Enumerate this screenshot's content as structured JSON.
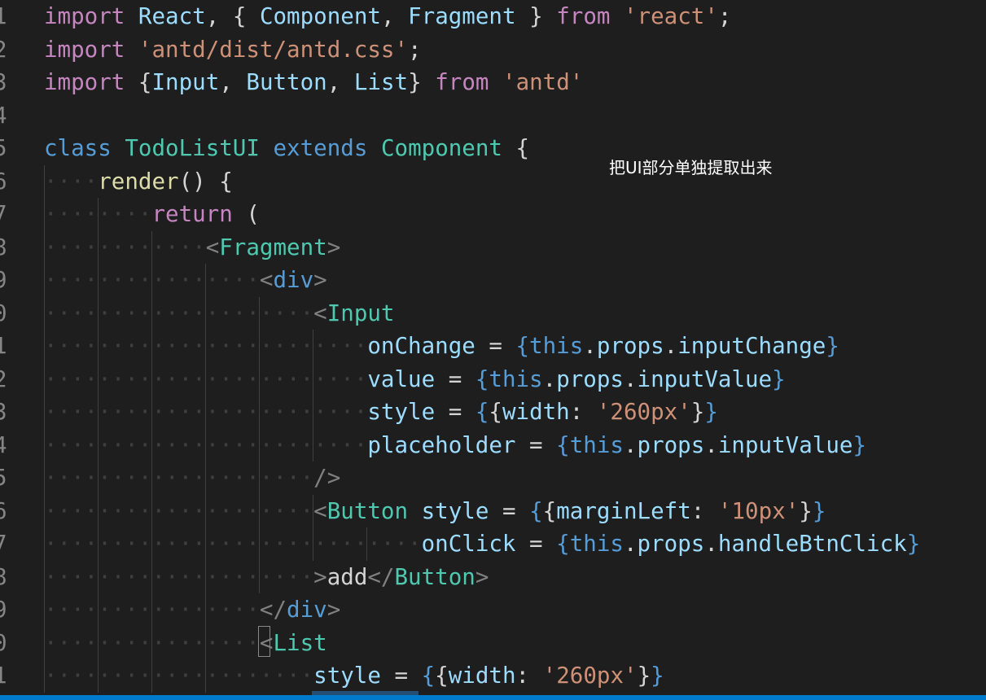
{
  "editor": {
    "annotation": "把UI部分单独提取出来",
    "line_numbers": [
      "1",
      "2",
      "3",
      "4",
      "5",
      "6",
      "7",
      "8",
      "9",
      "0",
      "1",
      "2",
      "3",
      "4",
      "5",
      "6",
      "7",
      "8",
      "9",
      "0",
      "1"
    ],
    "lines": [
      [
        {
          "t": "import",
          "c": "kw"
        },
        {
          "t": " ",
          "c": "ws"
        },
        {
          "t": "React",
          "c": "var"
        },
        {
          "t": ", { ",
          "c": "pun"
        },
        {
          "t": "Component",
          "c": "var"
        },
        {
          "t": ", ",
          "c": "pun"
        },
        {
          "t": "Fragment",
          "c": "var"
        },
        {
          "t": " } ",
          "c": "pun"
        },
        {
          "t": "from",
          "c": "kw"
        },
        {
          "t": " ",
          "c": "ws"
        },
        {
          "t": "'react'",
          "c": "str"
        },
        {
          "t": ";",
          "c": "pun"
        }
      ],
      [
        {
          "t": "import",
          "c": "kw"
        },
        {
          "t": " ",
          "c": "ws"
        },
        {
          "t": "'antd/dist/antd.css'",
          "c": "str"
        },
        {
          "t": ";",
          "c": "pun"
        }
      ],
      [
        {
          "t": "import",
          "c": "kw"
        },
        {
          "t": " {",
          "c": "pun"
        },
        {
          "t": "Input",
          "c": "var"
        },
        {
          "t": ", ",
          "c": "pun"
        },
        {
          "t": "Button",
          "c": "var"
        },
        {
          "t": ", ",
          "c": "pun"
        },
        {
          "t": "List",
          "c": "var"
        },
        {
          "t": "} ",
          "c": "pun"
        },
        {
          "t": "from",
          "c": "kw"
        },
        {
          "t": " ",
          "c": "ws"
        },
        {
          "t": "'antd'",
          "c": "str"
        }
      ],
      [],
      [
        {
          "t": "class",
          "c": "st"
        },
        {
          "t": " ",
          "c": "ws"
        },
        {
          "t": "TodoListUI",
          "c": "ty"
        },
        {
          "t": " ",
          "c": "ws"
        },
        {
          "t": "extends",
          "c": "st"
        },
        {
          "t": " ",
          "c": "ws"
        },
        {
          "t": "Component",
          "c": "ty"
        },
        {
          "t": " {",
          "c": "pun"
        }
      ],
      [
        {
          "t": "····",
          "c": "ws"
        },
        {
          "t": "render",
          "c": "fn"
        },
        {
          "t": "() {",
          "c": "pun"
        }
      ],
      [
        {
          "t": "········",
          "c": "ws"
        },
        {
          "t": "return",
          "c": "kw"
        },
        {
          "t": " (",
          "c": "pun"
        }
      ],
      [
        {
          "t": "············",
          "c": "ws"
        },
        {
          "t": "<",
          "c": "tag"
        },
        {
          "t": "Fragment",
          "c": "ty"
        },
        {
          "t": ">",
          "c": "tag"
        }
      ],
      [
        {
          "t": "················",
          "c": "ws"
        },
        {
          "t": "<",
          "c": "tag"
        },
        {
          "t": "div",
          "c": "st"
        },
        {
          "t": ">",
          "c": "tag"
        }
      ],
      [
        {
          "t": "····················",
          "c": "ws"
        },
        {
          "t": "<",
          "c": "tag"
        },
        {
          "t": "Input",
          "c": "ty"
        }
      ],
      [
        {
          "t": "························",
          "c": "ws"
        },
        {
          "t": "onChange",
          "c": "var"
        },
        {
          "t": " = ",
          "c": "pun"
        },
        {
          "t": "{",
          "c": "brc"
        },
        {
          "t": "this",
          "c": "st"
        },
        {
          "t": ".",
          "c": "pun"
        },
        {
          "t": "props",
          "c": "var"
        },
        {
          "t": ".",
          "c": "pun"
        },
        {
          "t": "inputChange",
          "c": "var"
        },
        {
          "t": "}",
          "c": "brc"
        }
      ],
      [
        {
          "t": "························",
          "c": "ws"
        },
        {
          "t": "value",
          "c": "var"
        },
        {
          "t": " = ",
          "c": "pun"
        },
        {
          "t": "{",
          "c": "brc"
        },
        {
          "t": "this",
          "c": "st"
        },
        {
          "t": ".",
          "c": "pun"
        },
        {
          "t": "props",
          "c": "var"
        },
        {
          "t": ".",
          "c": "pun"
        },
        {
          "t": "inputValue",
          "c": "var"
        },
        {
          "t": "}",
          "c": "brc"
        }
      ],
      [
        {
          "t": "························",
          "c": "ws"
        },
        {
          "t": "style",
          "c": "var"
        },
        {
          "t": " = ",
          "c": "pun"
        },
        {
          "t": "{",
          "c": "brc"
        },
        {
          "t": "{",
          "c": "pun"
        },
        {
          "t": "width",
          "c": "var"
        },
        {
          "t": ": ",
          "c": "pun"
        },
        {
          "t": "'260px'",
          "c": "str"
        },
        {
          "t": "}",
          "c": "pun"
        },
        {
          "t": "}",
          "c": "brc"
        }
      ],
      [
        {
          "t": "························",
          "c": "ws"
        },
        {
          "t": "placeholder",
          "c": "var"
        },
        {
          "t": " = ",
          "c": "pun"
        },
        {
          "t": "{",
          "c": "brc"
        },
        {
          "t": "this",
          "c": "st"
        },
        {
          "t": ".",
          "c": "pun"
        },
        {
          "t": "props",
          "c": "var"
        },
        {
          "t": ".",
          "c": "pun"
        },
        {
          "t": "inputValue",
          "c": "var"
        },
        {
          "t": "}",
          "c": "brc"
        }
      ],
      [
        {
          "t": "····················",
          "c": "ws"
        },
        {
          "t": "/>",
          "c": "tag"
        }
      ],
      [
        {
          "t": "····················",
          "c": "ws"
        },
        {
          "t": "<",
          "c": "tag"
        },
        {
          "t": "Button",
          "c": "ty"
        },
        {
          "t": " ",
          "c": "ws"
        },
        {
          "t": "style",
          "c": "var"
        },
        {
          "t": " = ",
          "c": "pun"
        },
        {
          "t": "{",
          "c": "brc"
        },
        {
          "t": "{",
          "c": "pun"
        },
        {
          "t": "marginLeft",
          "c": "var"
        },
        {
          "t": ": ",
          "c": "pun"
        },
        {
          "t": "'10px'",
          "c": "str"
        },
        {
          "t": "}",
          "c": "pun"
        },
        {
          "t": "}",
          "c": "brc"
        }
      ],
      [
        {
          "t": "····························",
          "c": "ws"
        },
        {
          "t": "onClick",
          "c": "var"
        },
        {
          "t": " = ",
          "c": "pun"
        },
        {
          "t": "{",
          "c": "brc"
        },
        {
          "t": "this",
          "c": "st"
        },
        {
          "t": ".",
          "c": "pun"
        },
        {
          "t": "props",
          "c": "var"
        },
        {
          "t": ".",
          "c": "pun"
        },
        {
          "t": "handleBtnClick",
          "c": "var"
        },
        {
          "t": "}",
          "c": "brc"
        }
      ],
      [
        {
          "t": "····················",
          "c": "ws"
        },
        {
          "t": ">",
          "c": "tag"
        },
        {
          "t": "add",
          "c": "pun"
        },
        {
          "t": "</",
          "c": "tag"
        },
        {
          "t": "Button",
          "c": "ty"
        },
        {
          "t": ">",
          "c": "tag"
        }
      ],
      [
        {
          "t": "················",
          "c": "ws"
        },
        {
          "t": "</",
          "c": "tag"
        },
        {
          "t": "div",
          "c": "st"
        },
        {
          "t": ">",
          "c": "tag"
        }
      ],
      [
        {
          "t": "················",
          "c": "ws"
        },
        {
          "t": "<",
          "c": "tag"
        },
        {
          "t": "List",
          "c": "ty"
        }
      ],
      [
        {
          "t": "····················",
          "c": "ws"
        },
        {
          "t": "style",
          "c": "var"
        },
        {
          "t": " = ",
          "c": "pun"
        },
        {
          "t": "{",
          "c": "brc"
        },
        {
          "t": "{",
          "c": "pun"
        },
        {
          "t": "width",
          "c": "var"
        },
        {
          "t": ": ",
          "c": "pun"
        },
        {
          "t": "'260px'",
          "c": "str"
        },
        {
          "t": "}",
          "c": "pun"
        },
        {
          "t": "}",
          "c": "brc"
        }
      ]
    ]
  }
}
